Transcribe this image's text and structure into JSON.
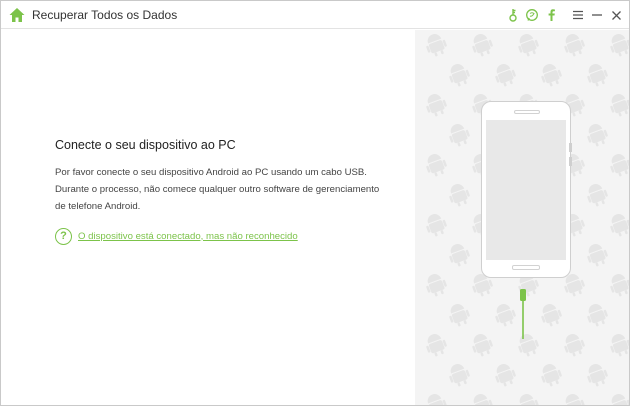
{
  "window": {
    "title": "Recuperar Todos os Dados"
  },
  "titlebar": {
    "icons": [
      "key-icon",
      "chat-icon",
      "facebook-icon",
      "menu-icon",
      "minimize-icon",
      "close-icon"
    ],
    "accent": "#7cc34a"
  },
  "main": {
    "heading": "Conecte o seu dispositivo ao PC",
    "description": "Por favor conecte o seu dispositivo Android ao PC usando um cabo USB. Durante o processo, não comece qualquer outro software de gerenciamento de telefone Android.",
    "help_icon": "?",
    "help_link": "O dispositivo está conectado, mas não reconhecido"
  },
  "colors": {
    "accent": "#7cc34a",
    "right_panel_bg": "#f4f4f4",
    "phone_screen": "#e8e8e8"
  }
}
